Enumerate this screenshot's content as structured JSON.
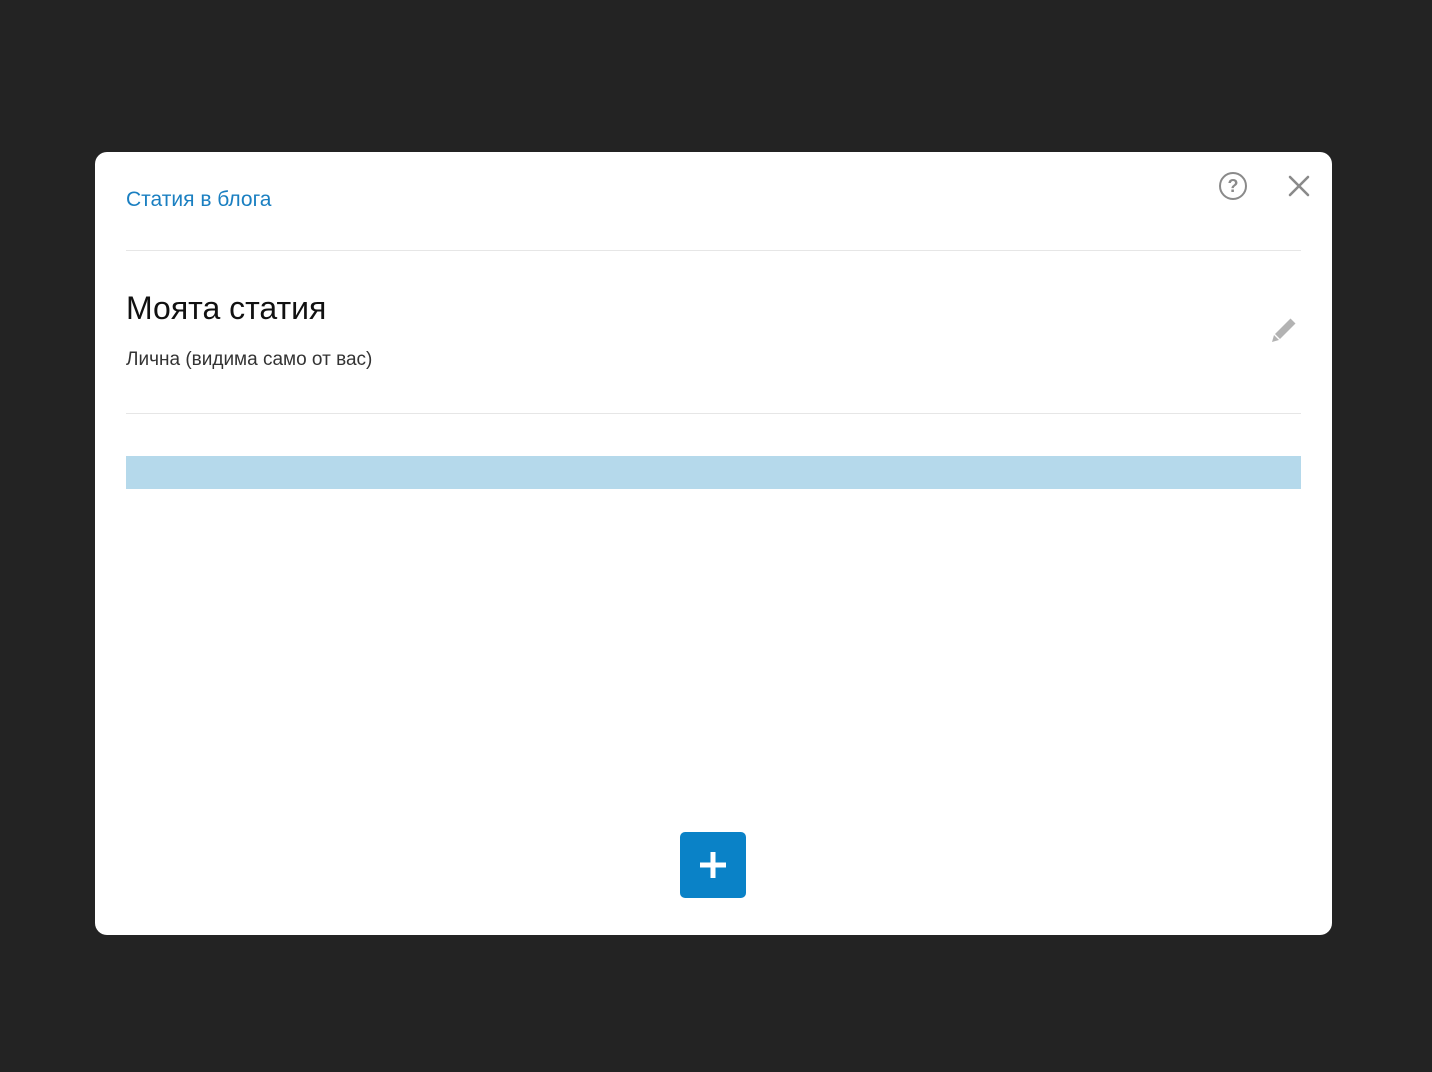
{
  "modal": {
    "breadcrumb": "Статия в блога",
    "title": "Моята статия",
    "subtitle": "Лична (видима само от вас)",
    "icons": {
      "help": "question-circle-icon",
      "close": "close-icon",
      "edit": "pencil-icon",
      "add": "plus-icon"
    },
    "colors": {
      "accent": "#0a82c7",
      "link": "#1a7fc1",
      "highlight_bar": "#b5d9eb",
      "backdrop": "#232323"
    }
  }
}
